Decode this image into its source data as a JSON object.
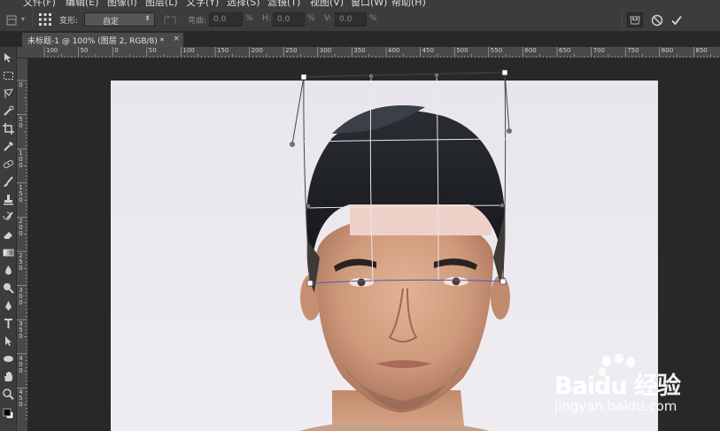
{
  "menubar": {
    "items": [
      {
        "label": "文件(F)"
      },
      {
        "label": "编辑(E)"
      },
      {
        "label": "图像(I)"
      },
      {
        "label": "图层(L)"
      },
      {
        "label": "文字(Y)"
      },
      {
        "label": "选择(S)"
      },
      {
        "label": "滤镜(T)"
      },
      {
        "label": "视图(V)"
      },
      {
        "label": "窗口(W)"
      },
      {
        "label": "帮助(H)"
      }
    ]
  },
  "options": {
    "warp_label": "变形:",
    "warp_value": "自定",
    "bend_label": "弯曲:",
    "bend_value": "0.0",
    "bend_unit": "%",
    "h_label": "H:",
    "h_value": "0.0",
    "h_unit": "%",
    "v_label": "V:",
    "v_value": "0.0",
    "v_unit": "%"
  },
  "document": {
    "tab_title": "未标题-1 @ 100% (图层 2, RGB/8) *",
    "close_glyph": "×"
  },
  "ruler": {
    "top_labels": [
      "100",
      "50",
      "0",
      "50",
      "100",
      "150",
      "200",
      "250",
      "300",
      "350",
      "400",
      "450",
      "500",
      "550",
      "600",
      "650",
      "700",
      "750",
      "800",
      "850"
    ],
    "left_labels": [
      "0",
      "5 0",
      "1 0 0",
      "1 5 0",
      "2 0 0",
      "2 5 0",
      "3 0 0",
      "3 5 0",
      "4 0 0",
      "4 5 0"
    ]
  },
  "watermark": {
    "brand": "Baidu 经验",
    "url": "jingyan.baidu.com"
  },
  "icons": {
    "toolbar": [
      "move-icon",
      "marquee-icon",
      "lasso-icon",
      "quick-select-icon",
      "crop-icon",
      "eyedropper-icon",
      "healing-icon",
      "brush-icon",
      "stamp-icon",
      "history-brush-icon",
      "eraser-icon",
      "gradient-icon",
      "blur-icon",
      "dodge-icon",
      "pen-icon",
      "type-icon",
      "path-select-icon",
      "shape-icon",
      "hand-icon",
      "zoom-icon"
    ],
    "options_right": [
      "warp-mode-icon",
      "cancel-icon",
      "commit-icon"
    ]
  },
  "colors": {
    "ui_panel": "#3c3c3c",
    "workspace": "#282828",
    "canvas_bg": "#ecebef",
    "warp_grid": "#444444"
  }
}
